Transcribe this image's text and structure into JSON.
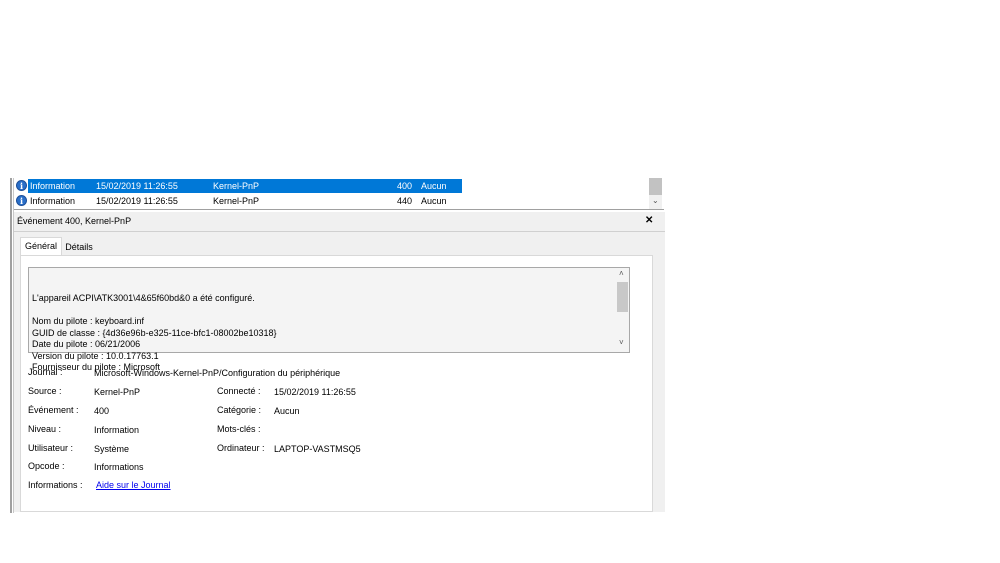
{
  "events": [
    {
      "level": "Information",
      "date": "15/02/2019 11:26:55",
      "source": "Kernel-PnP",
      "id": "400",
      "category": "Aucun",
      "selected": true
    },
    {
      "level": "Information",
      "date": "15/02/2019 11:26:55",
      "source": "Kernel-PnP",
      "id": "440",
      "category": "Aucun",
      "selected": false
    }
  ],
  "detail": {
    "title": "Événement 400, Kernel-PnP",
    "close": "✕",
    "tabs": [
      "Général",
      "Détails"
    ],
    "message": [
      "L'appareil ACPI\\ATK3001\\4&65f60bd&0 a été configuré.",
      "",
      "Nom du pilote : keyboard.inf",
      "GUID de classe : {4d36e96b-e325-11ce-bfc1-08002be10318}",
      "Date du pilote : 06/21/2006",
      "Version du pilote : 10.0.17763.1",
      "Fournisseur du pilote : Microsoft"
    ],
    "fields": {
      "journal_l": "Journal :",
      "journal": "Microsoft-Windows-Kernel-PnP/Configuration du périphérique",
      "source_l": "Source :",
      "source": "Kernel-PnP",
      "connecte_l": "Connecté :",
      "connecte": "15/02/2019 11:26:55",
      "evenement_l": "Événement :",
      "evenement": "400",
      "categorie_l": "Catégorie :",
      "categorie": "Aucun",
      "niveau_l": "Niveau :",
      "niveau": "Information",
      "motscles_l": "Mots-clés :",
      "utilisateur_l": "Utilisateur :",
      "utilisateur": "Système",
      "ordinateur_l": "Ordinateur :",
      "ordinateur": "LAPTOP-VASTMSQ5",
      "opcode_l": "Opcode :",
      "opcode": "Informations",
      "informations_l": "Informations :",
      "informations": "Aide sur le Journal"
    }
  }
}
